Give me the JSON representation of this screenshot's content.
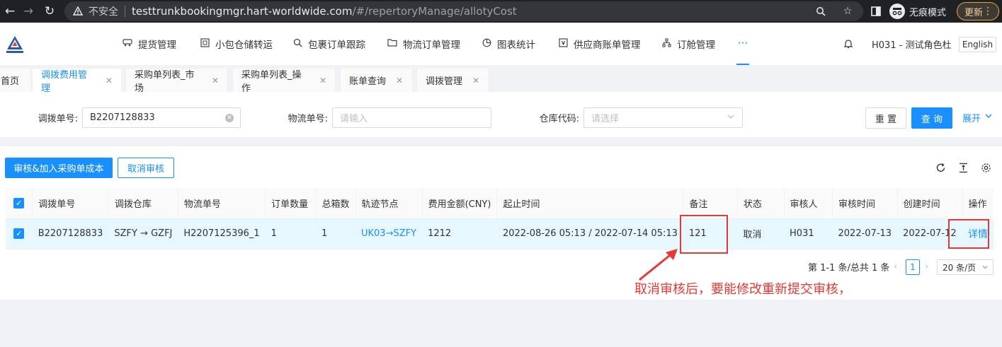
{
  "browser": {
    "insecure_label": "不安全",
    "url_host": "testtrunkbookingmgr.hart-worldwide.com",
    "url_path": "/#/repertoryManage/allotyCost",
    "incognito_label": "无痕模式",
    "update_label": "更新"
  },
  "header": {
    "menu": [
      {
        "label": "提货管理",
        "icon": "truck-icon"
      },
      {
        "label": "小包仓储转运",
        "icon": "box-icon"
      },
      {
        "label": "包裹订单跟踪",
        "icon": "search-icon"
      },
      {
        "label": "物流订单管理",
        "icon": "folder-icon"
      },
      {
        "label": "图表统计",
        "icon": "pie-chart-icon"
      },
      {
        "label": "供应商账单管理",
        "icon": "bill-icon"
      },
      {
        "label": "订舱管理",
        "icon": "network-icon"
      }
    ],
    "more_label": "···",
    "user_label": "H031 - 测试角色杜",
    "lang_label": "English"
  },
  "tabs": [
    {
      "label": "首页"
    },
    {
      "label": "调拨费用管理"
    },
    {
      "label": "采购单列表_市场"
    },
    {
      "label": "采购单列表_操作"
    },
    {
      "label": "账单查询"
    },
    {
      "label": "调拨管理"
    }
  ],
  "search": {
    "transfer_no_label": "调拨单号:",
    "transfer_no_value": "B2207128833",
    "logistics_no_label": "物流单号:",
    "logistics_no_placeholder": "请输入",
    "warehouse_label": "仓库代码:",
    "warehouse_placeholder": "请选择",
    "reset_label": "重 置",
    "query_label": "查 询",
    "expand_label": "展开"
  },
  "actions": {
    "audit_label": "审核&加入采购单成本",
    "cancel_audit_label": "取消审核"
  },
  "table": {
    "columns": [
      "调拨单号",
      "调拨仓库",
      "物流单号",
      "订单数量",
      "总箱数",
      "轨迹节点",
      "费用金额(CNY)",
      "起止时间",
      "备注",
      "状态",
      "审核人",
      "审核时间",
      "创建时间",
      "操作"
    ],
    "rows": [
      {
        "transfer_no": "B2207128833",
        "warehouse": "SZFY → GZFJ",
        "logistics_no": "H2207125396_1",
        "order_count": "1",
        "box_count": "1",
        "track_node": "UK03→SZFY",
        "amount": "1212",
        "time_range": "2022-08-26 05:13 / 2022-07-14 05:13",
        "remark": "121",
        "status": "取消",
        "auditor": "H031",
        "audit_time": "2022-07-13",
        "create_time": "2022-07-12",
        "action": "详情"
      }
    ]
  },
  "pagination": {
    "summary": "第 1-1 条/总共 1 条",
    "current_page": "1",
    "page_size_label": "20 条/页"
  },
  "annotation": {
    "text": "取消审核后，要能修改重新提交审核，",
    "color": "#e53935"
  }
}
